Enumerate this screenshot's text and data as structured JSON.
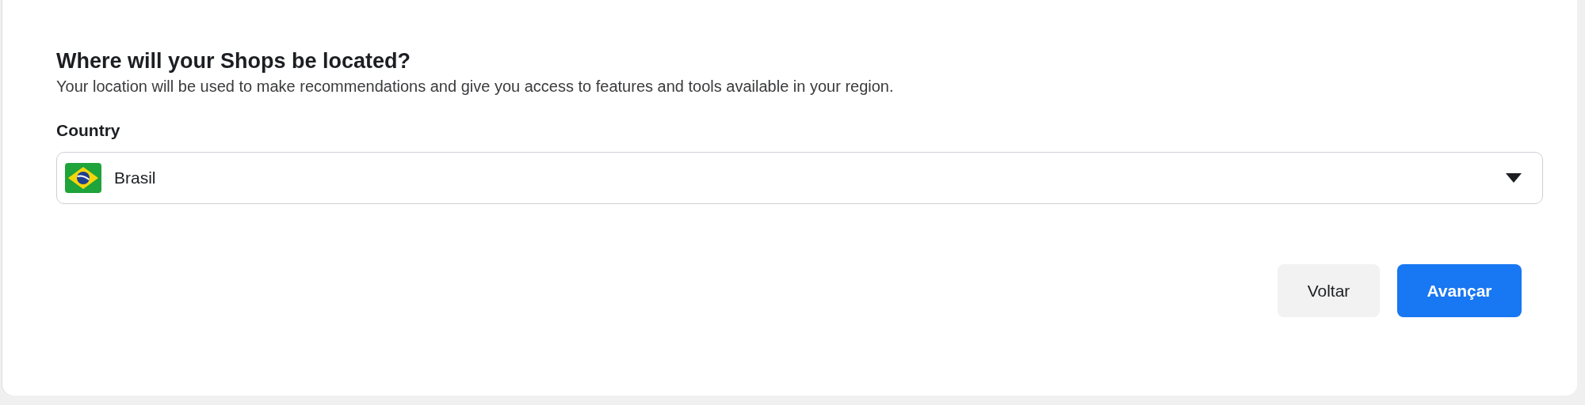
{
  "title": "Where will your Shops be located?",
  "subtitle": "Your location will be used to make recommendations and give you access to features and tools available in your region.",
  "country_field": {
    "label": "Country",
    "value": "Brasil"
  },
  "buttons": [
    {
      "label": "Voltar",
      "kind": "secondary"
    },
    {
      "label": "Avançar",
      "kind": "primary"
    }
  ]
}
